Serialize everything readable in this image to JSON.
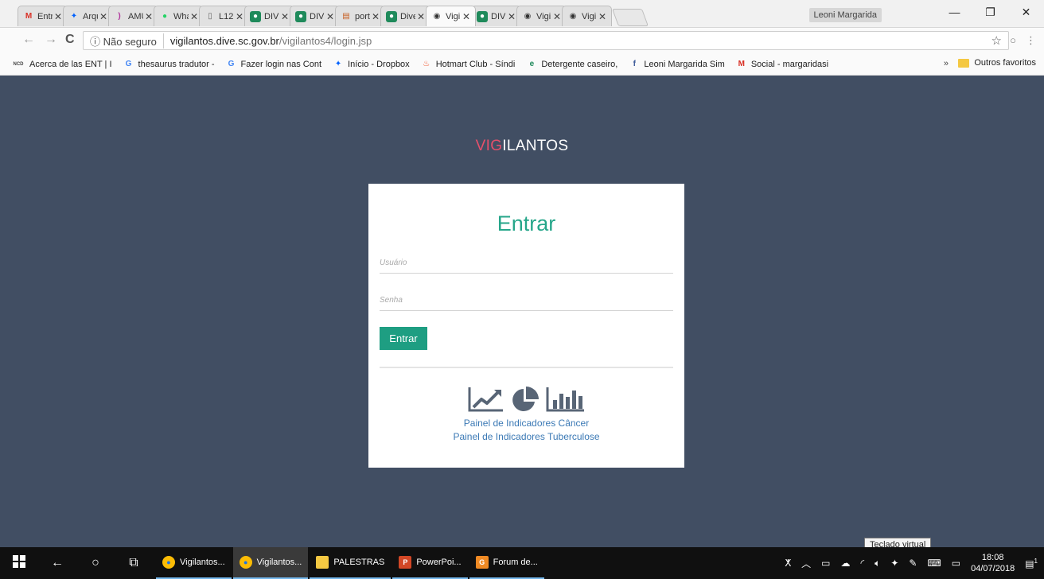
{
  "browser": {
    "tabs": [
      {
        "label": "Entr",
        "icon": "gmail-icon",
        "fav_char": "M",
        "fav_color": "#d93025",
        "fav_bg": "transparent"
      },
      {
        "label": "Arqu",
        "icon": "dropbox-icon",
        "fav_char": "✦",
        "fav_color": "#0061fe",
        "fav_bg": "transparent"
      },
      {
        "label": "AMU",
        "icon": "ribbon-icon",
        "fav_char": ")",
        "fav_color": "#b0359c",
        "fav_bg": "transparent"
      },
      {
        "label": "Wha",
        "icon": "whatsapp-icon",
        "fav_char": "●",
        "fav_color": "#25d366",
        "fav_bg": "transparent"
      },
      {
        "label": "L12",
        "icon": "document-icon",
        "fav_char": "▯",
        "fav_color": "#666666",
        "fav_bg": "transparent"
      },
      {
        "label": "DIVE",
        "icon": "dive-icon",
        "fav_char": "●",
        "fav_color": "#ffffff",
        "fav_bg": "#1f8a5b"
      },
      {
        "label": "DIVE",
        "icon": "dive-icon",
        "fav_char": "●",
        "fav_color": "#ffffff",
        "fav_bg": "#1f8a5b"
      },
      {
        "label": "port",
        "icon": "portal-icon",
        "fav_char": "▤",
        "fav_color": "#c65d20",
        "fav_bg": "transparent"
      },
      {
        "label": "Dive",
        "icon": "dive-icon",
        "fav_char": "●",
        "fav_color": "#ffffff",
        "fav_bg": "#1f8a5b"
      },
      {
        "label": "Vigi",
        "icon": "eye-icon",
        "fav_char": "◉",
        "fav_color": "#333333",
        "fav_bg": "transparent",
        "active": true
      },
      {
        "label": "DIVE",
        "icon": "dive-icon",
        "fav_char": "●",
        "fav_color": "#ffffff",
        "fav_bg": "#1f8a5b"
      },
      {
        "label": "Vigi",
        "icon": "eye-icon",
        "fav_char": "◉",
        "fav_color": "#333333",
        "fav_bg": "transparent"
      },
      {
        "label": "Vigi",
        "icon": "eye-icon",
        "fav_char": "◉",
        "fav_color": "#333333",
        "fav_bg": "transparent"
      }
    ],
    "tab_close": "✕",
    "profile_name": "Leoni Margarida",
    "window_controls": {
      "minimize": "—",
      "maximize": "❐",
      "close": "✕"
    },
    "nav": {
      "back": "←",
      "forward": "→",
      "reload": "C"
    },
    "address": {
      "security_label": "ⓘ Não seguro",
      "host": "vigilantos.dive.sc.gov.br",
      "path": "/vigilantos4/login.jsp",
      "star": "☆"
    },
    "toolbar_icons": {
      "extension": "○",
      "menu": "⋮"
    },
    "bookmarks": [
      {
        "label": "Acerca de las ENT | I",
        "icon": "ncd-icon",
        "char": "NCD",
        "color": "#444444"
      },
      {
        "label": "thesaurus tradutor -",
        "icon": "google-icon",
        "char": "G",
        "color": "#4285f4"
      },
      {
        "label": "Fazer login nas Cont",
        "icon": "google-icon",
        "char": "G",
        "color": "#4285f4"
      },
      {
        "label": "Início - Dropbox",
        "icon": "dropbox-icon",
        "char": "✦",
        "color": "#0061fe"
      },
      {
        "label": "Hotmart Club - Síndi",
        "icon": "flame-icon",
        "char": "♨",
        "color": "#f04e23"
      },
      {
        "label": "Detergente caseiro,",
        "icon": "site-icon",
        "char": "e",
        "color": "#1f8a5b"
      },
      {
        "label": "Leoni Margarida Sim",
        "icon": "facebook-icon",
        "char": "f",
        "color": "#3b5998"
      },
      {
        "label": "Social - margaridasi",
        "icon": "gmail-icon",
        "char": "M",
        "color": "#d93025"
      }
    ],
    "bookmarks_more": "»",
    "other_bookmarks": "Outros favoritos"
  },
  "page": {
    "brand_accent": "VIG",
    "brand_rest": "ILANTOS",
    "login": {
      "title": "Entrar",
      "username_placeholder": "Usuário",
      "password_placeholder": "Senha",
      "submit_label": "Entrar"
    },
    "panel_links": [
      "Painel de Indicadores Câncer",
      "Painel de Indicadores Tuberculose"
    ],
    "colors": {
      "background": "#414e63",
      "accent_green": "#26a68a",
      "brand_red": "#e5506b",
      "link_blue": "#3b79b5",
      "icon_gray": "#586576"
    }
  },
  "tooltip": "Teclado virtual",
  "taskbar": {
    "apps": [
      {
        "label": "Vigilantos...",
        "icon": "chrome-icon",
        "active": false
      },
      {
        "label": "Vigilantos...",
        "icon": "chrome-icon",
        "active": true
      },
      {
        "label": "PALESTRAS",
        "icon": "folder-icon",
        "active": false
      },
      {
        "label": "PowerPoi...",
        "icon": "powerpoint-icon",
        "active": false
      },
      {
        "label": "Forum de...",
        "icon": "forum-icon",
        "active": false
      }
    ],
    "time": "18:08",
    "date": "04/07/2018",
    "notification_count": "1"
  }
}
